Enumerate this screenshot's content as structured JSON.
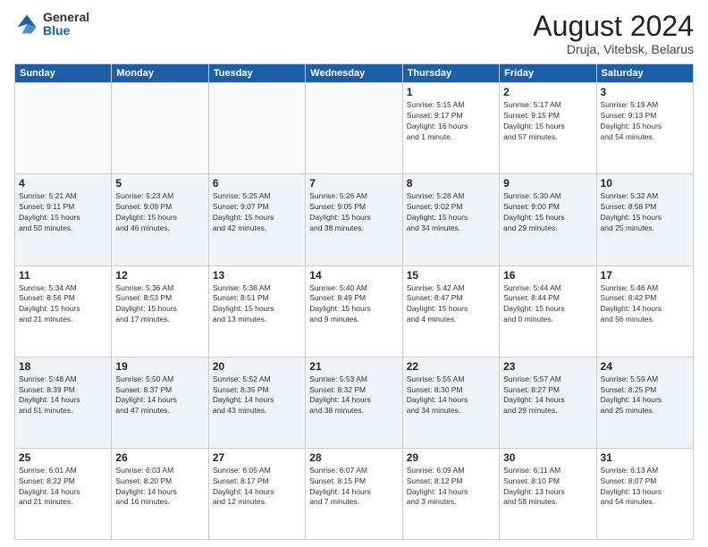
{
  "header": {
    "logo": {
      "general": "General",
      "blue": "Blue"
    },
    "title": "August 2024",
    "subtitle": "Druja, Vitebsk, Belarus"
  },
  "weekdays": [
    "Sunday",
    "Monday",
    "Tuesday",
    "Wednesday",
    "Thursday",
    "Friday",
    "Saturday"
  ],
  "weeks": [
    [
      {
        "day": "",
        "info": ""
      },
      {
        "day": "",
        "info": ""
      },
      {
        "day": "",
        "info": ""
      },
      {
        "day": "",
        "info": ""
      },
      {
        "day": "1",
        "info": "Sunrise: 5:15 AM\nSunset: 9:17 PM\nDaylight: 16 hours\nand 1 minute."
      },
      {
        "day": "2",
        "info": "Sunrise: 5:17 AM\nSunset: 9:15 PM\nDaylight: 15 hours\nand 57 minutes."
      },
      {
        "day": "3",
        "info": "Sunrise: 5:19 AM\nSunset: 9:13 PM\nDaylight: 15 hours\nand 54 minutes."
      }
    ],
    [
      {
        "day": "4",
        "info": "Sunrise: 5:21 AM\nSunset: 9:11 PM\nDaylight: 15 hours\nand 50 minutes."
      },
      {
        "day": "5",
        "info": "Sunrise: 5:23 AM\nSunset: 9:09 PM\nDaylight: 15 hours\nand 46 minutes."
      },
      {
        "day": "6",
        "info": "Sunrise: 5:25 AM\nSunset: 9:07 PM\nDaylight: 15 hours\nand 42 minutes."
      },
      {
        "day": "7",
        "info": "Sunrise: 5:26 AM\nSunset: 9:05 PM\nDaylight: 15 hours\nand 38 minutes."
      },
      {
        "day": "8",
        "info": "Sunrise: 5:28 AM\nSunset: 9:02 PM\nDaylight: 15 hours\nand 34 minutes."
      },
      {
        "day": "9",
        "info": "Sunrise: 5:30 AM\nSunset: 9:00 PM\nDaylight: 15 hours\nand 29 minutes."
      },
      {
        "day": "10",
        "info": "Sunrise: 5:32 AM\nSunset: 8:58 PM\nDaylight: 15 hours\nand 25 minutes."
      }
    ],
    [
      {
        "day": "11",
        "info": "Sunrise: 5:34 AM\nSunset: 8:56 PM\nDaylight: 15 hours\nand 21 minutes."
      },
      {
        "day": "12",
        "info": "Sunrise: 5:36 AM\nSunset: 8:53 PM\nDaylight: 15 hours\nand 17 minutes."
      },
      {
        "day": "13",
        "info": "Sunrise: 5:38 AM\nSunset: 8:51 PM\nDaylight: 15 hours\nand 13 minutes."
      },
      {
        "day": "14",
        "info": "Sunrise: 5:40 AM\nSunset: 8:49 PM\nDaylight: 15 hours\nand 9 minutes."
      },
      {
        "day": "15",
        "info": "Sunrise: 5:42 AM\nSunset: 8:47 PM\nDaylight: 15 hours\nand 4 minutes."
      },
      {
        "day": "16",
        "info": "Sunrise: 5:44 AM\nSunset: 8:44 PM\nDaylight: 15 hours\nand 0 minutes."
      },
      {
        "day": "17",
        "info": "Sunrise: 5:46 AM\nSunset: 8:42 PM\nDaylight: 14 hours\nand 56 minutes."
      }
    ],
    [
      {
        "day": "18",
        "info": "Sunrise: 5:48 AM\nSunset: 8:39 PM\nDaylight: 14 hours\nand 51 minutes."
      },
      {
        "day": "19",
        "info": "Sunrise: 5:50 AM\nSunset: 8:37 PM\nDaylight: 14 hours\nand 47 minutes."
      },
      {
        "day": "20",
        "info": "Sunrise: 5:52 AM\nSunset: 8:35 PM\nDaylight: 14 hours\nand 43 minutes."
      },
      {
        "day": "21",
        "info": "Sunrise: 5:53 AM\nSunset: 8:32 PM\nDaylight: 14 hours\nand 38 minutes."
      },
      {
        "day": "22",
        "info": "Sunrise: 5:55 AM\nSunset: 8:30 PM\nDaylight: 14 hours\nand 34 minutes."
      },
      {
        "day": "23",
        "info": "Sunrise: 5:57 AM\nSunset: 8:27 PM\nDaylight: 14 hours\nand 29 minutes."
      },
      {
        "day": "24",
        "info": "Sunrise: 5:59 AM\nSunset: 8:25 PM\nDaylight: 14 hours\nand 25 minutes."
      }
    ],
    [
      {
        "day": "25",
        "info": "Sunrise: 6:01 AM\nSunset: 8:22 PM\nDaylight: 14 hours\nand 21 minutes."
      },
      {
        "day": "26",
        "info": "Sunrise: 6:03 AM\nSunset: 8:20 PM\nDaylight: 14 hours\nand 16 minutes."
      },
      {
        "day": "27",
        "info": "Sunrise: 6:05 AM\nSunset: 8:17 PM\nDaylight: 14 hours\nand 12 minutes."
      },
      {
        "day": "28",
        "info": "Sunrise: 6:07 AM\nSunset: 8:15 PM\nDaylight: 14 hours\nand 7 minutes."
      },
      {
        "day": "29",
        "info": "Sunrise: 6:09 AM\nSunset: 8:12 PM\nDaylight: 14 hours\nand 3 minutes."
      },
      {
        "day": "30",
        "info": "Sunrise: 6:11 AM\nSunset: 8:10 PM\nDaylight: 13 hours\nand 58 minutes."
      },
      {
        "day": "31",
        "info": "Sunrise: 6:13 AM\nSunset: 8:07 PM\nDaylight: 13 hours\nand 54 minutes."
      }
    ]
  ]
}
